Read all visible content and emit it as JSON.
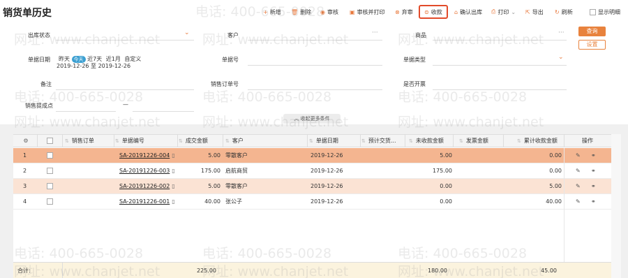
{
  "page": {
    "title": "销货单历史"
  },
  "toolbar": {
    "new": "新增",
    "delete": "删除",
    "audit": "审核",
    "audit_print": "审核并打印",
    "abandon": "弃审",
    "collect": "收款",
    "confirm_out": "确认出库",
    "print": "打印",
    "export": "导出",
    "refresh": "刷新",
    "show_detail": "显示明细"
  },
  "filters": {
    "out_status_label": "出库状态",
    "customer_label": "客户",
    "product_label": "商品",
    "doc_date_label": "单据日期",
    "date_quick": {
      "yesterday": "昨天",
      "today": "今天",
      "last7": "近7天",
      "last1m": "近1月",
      "custom": "自定义"
    },
    "date_from": "2019-12-26",
    "date_to_sep": "至",
    "date_to": "2019-12-26",
    "doc_no_label": "单据号",
    "doc_type_label": "单据类型",
    "remark_label": "备注",
    "sales_order_no_label": "销售订单号",
    "invoiced_label": "是否开票",
    "sales_commission_label": "销售提成点",
    "commission_value": "—",
    "query_button": "查询",
    "settings_button": "设置",
    "collapse_more": "收起更多条件"
  },
  "table": {
    "headers": {
      "sales_order": "销售订单",
      "doc_no": "单据编号",
      "amount": "成交金额",
      "customer": "客户",
      "doc_date": "单据日期",
      "expected_delivery": "预计交货...",
      "unpaid": "未收款金额",
      "invoice_amount": "发票金额",
      "accum_received": "累计收款金额",
      "ops": "操作"
    },
    "rows": [
      {
        "idx": "1",
        "doc_no": "SA-20191226-004",
        "amount": "5.00",
        "customer": "零散客户",
        "doc_date": "2019-12-26",
        "unpaid": "5.00",
        "accum_received": "0.00"
      },
      {
        "idx": "2",
        "doc_no": "SA-20191226-003",
        "amount": "175.00",
        "customer": "启航商贸",
        "doc_date": "2019-12-26",
        "unpaid": "175.00",
        "accum_received": "0.00"
      },
      {
        "idx": "3",
        "doc_no": "SA-20191226-002",
        "amount": "5.00",
        "customer": "零散客户",
        "doc_date": "2019-12-26",
        "unpaid": "0.00",
        "accum_received": "5.00"
      },
      {
        "idx": "4",
        "doc_no": "SA-20191226-001",
        "amount": "40.00",
        "customer": "张公子",
        "doc_date": "2019-12-26",
        "unpaid": "0.00",
        "accum_received": "40.00"
      }
    ],
    "footer": {
      "label": "合计:",
      "amount": "225.00",
      "unpaid": "180.00",
      "accum_received": "45.00"
    }
  },
  "watermark": {
    "phone": "电话: 400-665-0028",
    "site": "网址: www.chanjet.net"
  }
}
